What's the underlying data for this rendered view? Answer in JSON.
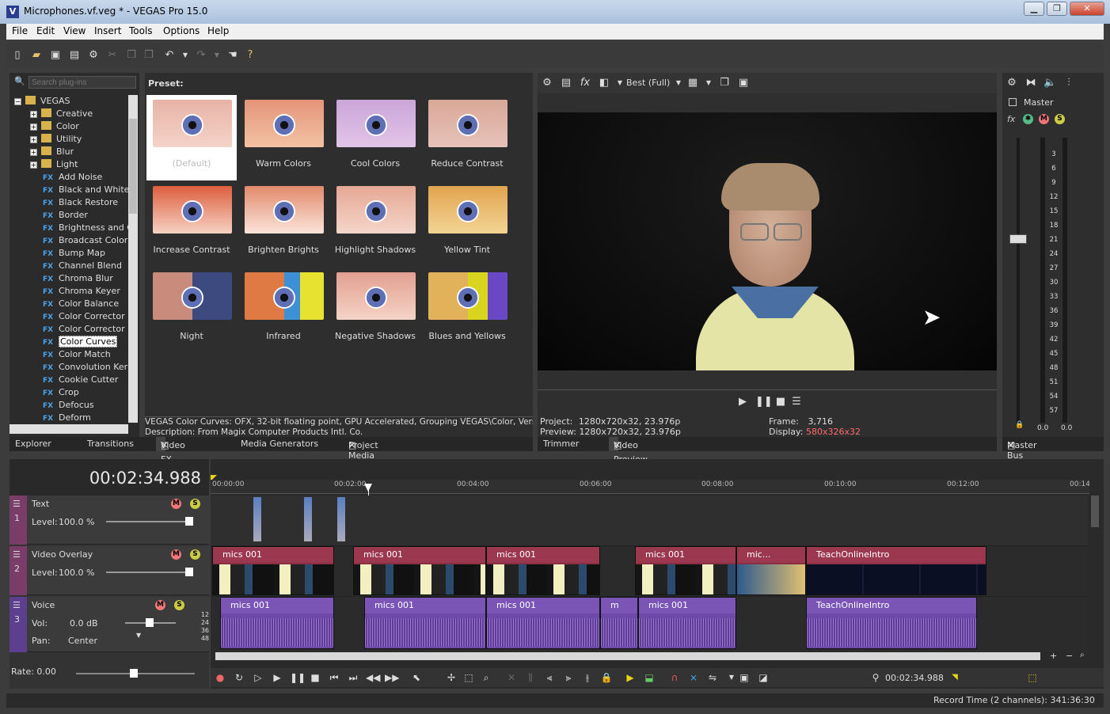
{
  "window": {
    "title": "Microphones.vf.veg * - VEGAS Pro 15.0",
    "icon": "V",
    "min": "▁",
    "max": "❐",
    "close": "✕"
  },
  "menu": [
    "File",
    "Edit",
    "View",
    "Insert",
    "Tools",
    "Options",
    "Help"
  ],
  "search": {
    "placeholder": "Search plug-ins"
  },
  "tree": {
    "root": "VEGAS",
    "folders": [
      "Creative",
      "Color",
      "Utility",
      "Blur",
      "Light"
    ],
    "fx": [
      "Add Noise",
      "Black and White",
      "Black Restore",
      "Border",
      "Brightness and Co",
      "Broadcast Colors",
      "Bump Map",
      "Channel Blend",
      "Chroma Blur",
      "Chroma Keyer",
      "Color Balance",
      "Color Corrector",
      "Color Corrector (S",
      "Color Curves",
      "Color Match",
      "Convolution Kerne",
      "Cookie Cutter",
      "Crop",
      "Defocus",
      "Deform"
    ],
    "selected": "Color Curves",
    "fxbadge": "FX"
  },
  "preset": {
    "label": "Preset:",
    "items": [
      "(Default)",
      "Warm Colors",
      "Cool Colors",
      "Reduce Contrast",
      "Increase Contrast",
      "Brighten Brights",
      "Highlight Shadows",
      "Yellow Tint",
      "Night",
      "Infrared",
      "Negative Shadows",
      "Blues and Yellows"
    ],
    "desc1": "VEGAS Color Curves: OFX, 32-bit floating point, GPU Accelerated, Grouping VEGAS\\Color, Version 1.0",
    "desc2": "Description: From Magix Computer Products Intl. Co."
  },
  "preview": {
    "quality": "Best (Full)",
    "project_label": "Project:",
    "project": "1280x720x32, 23.976p",
    "preview_label": "Preview:",
    "preview": "1280x720x32, 23.976p",
    "frame_label": "Frame:",
    "frame": "3,716",
    "display_label": "Display:",
    "display": "580x326x32"
  },
  "master": {
    "label": "Master",
    "scale": [
      "3",
      "6",
      "9",
      "12",
      "15",
      "18",
      "21",
      "24",
      "27",
      "30",
      "33",
      "36",
      "39",
      "42",
      "45",
      "48",
      "51",
      "54",
      "57"
    ],
    "left": "0.0",
    "right": "0.0"
  },
  "tabs": {
    "explorer": "Explorer",
    "transitions": "Transitions",
    "videofx": "Video FX",
    "mediagen": "Media Generators",
    "projmedia": "Project Media",
    "trimmer": "Trimmer",
    "videopreview": "Video Preview",
    "masterbus": "Master Bus"
  },
  "timecode": "00:02:34.988",
  "tracks": [
    {
      "num": "1",
      "name": "Text",
      "param": "Level:",
      "value": "100.0 %"
    },
    {
      "num": "2",
      "name": "Video Overlay",
      "param": "Level:",
      "value": "100.0 %"
    },
    {
      "num": "3",
      "name": "Voice",
      "param": "Vol:",
      "value": "0.0 dB",
      "param2": "Pan:",
      "value2": "Center"
    }
  ],
  "meter_ticks": [
    "12",
    "24",
    "36",
    "48"
  ],
  "ruler": [
    "00:00:00",
    "00:02:00",
    "00:04:00",
    "00:06:00",
    "00:08:00",
    "00:10:00",
    "00:12:00",
    "00:14"
  ],
  "video_clips": [
    "mics 001",
    "mics 001",
    "mics 001",
    "mics 001",
    "mic...",
    "TeachOnlineIntro"
  ],
  "audio_clips": [
    "mics 001",
    "mics 001",
    "mics 001",
    "m",
    "mics 001",
    "TeachOnlineIntro"
  ],
  "fx_label": "fx",
  "rate": "Rate: 0.00",
  "transport_time": "00:02:34.988",
  "status": "Record Time (2 channels): 341:36:30",
  "colors": {
    "video_track": "#8a2f41",
    "audio_track": "#6d49a8",
    "display_value": "#ff6b6b"
  }
}
